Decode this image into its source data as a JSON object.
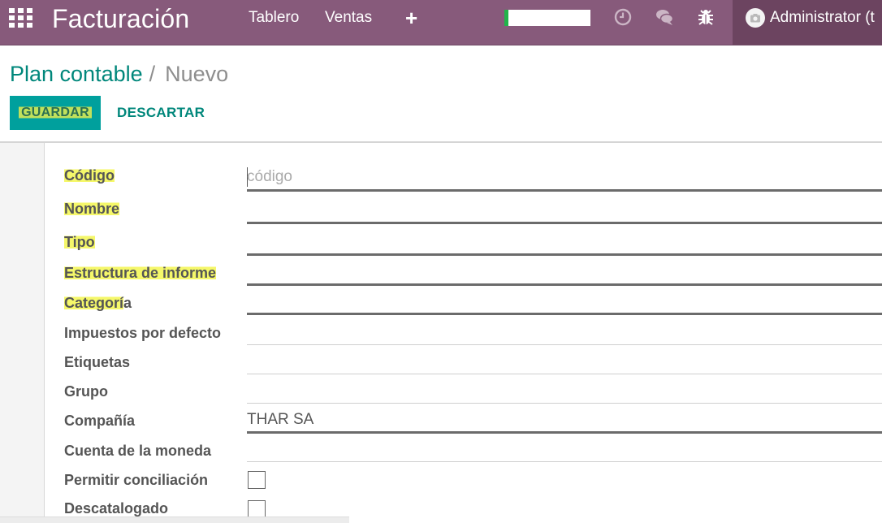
{
  "navbar": {
    "app_title": "Facturación",
    "menu": [
      "Tablero",
      "Ventas"
    ],
    "progress_fraction": 0.05,
    "user_name": "Administrator (t",
    "colors": {
      "bar": "#875a7b",
      "user_bg": "#6c4460",
      "progress": "#21b34a"
    },
    "icons": [
      "apps-grid-icon",
      "plus-icon",
      "clock-icon",
      "chat-icon",
      "bug-icon",
      "camera-icon"
    ]
  },
  "breadcrumb": {
    "parent": "Plan contable",
    "separator": "/",
    "current": "Nuevo"
  },
  "buttons": {
    "save": "GUARDAR",
    "discard": "DESCARTAR"
  },
  "form": {
    "code": {
      "label": "Código",
      "placeholder": "código",
      "value": ""
    },
    "name": {
      "label": "Nombre"
    },
    "type": {
      "label": "Tipo"
    },
    "report_structure": {
      "label": "Estructura de informe"
    },
    "category": {
      "label_hl": "Categorí",
      "label_rest": "a"
    },
    "default_taxes": {
      "label": "Impuestos por defecto"
    },
    "tags": {
      "label": "Etiquetas"
    },
    "group": {
      "label": "Grupo"
    },
    "company": {
      "label": "Compañía",
      "value": "THAR SA"
    },
    "currency": {
      "label": "Cuenta de la moneda"
    },
    "reconcile": {
      "label": "Permitir conciliación",
      "checked": false
    },
    "deprecated": {
      "label": "Descatalogado",
      "checked": false
    }
  }
}
